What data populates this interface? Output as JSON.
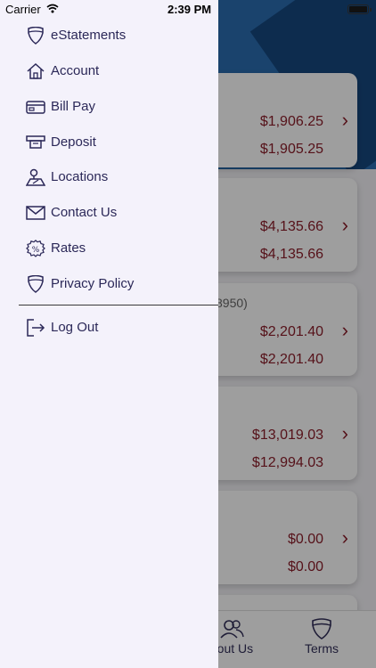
{
  "status_bar": {
    "carrier": "Carrier",
    "time": "2:39 PM"
  },
  "drawer": {
    "items": [
      {
        "label": "eStatements",
        "icon": "shield-icon"
      },
      {
        "label": "Account",
        "icon": "home-icon"
      },
      {
        "label": "Bill Pay",
        "icon": "card-icon"
      },
      {
        "label": "Deposit",
        "icon": "deposit-icon"
      },
      {
        "label": "Locations",
        "icon": "map-pin-icon"
      },
      {
        "label": "Contact Us",
        "icon": "envelope-icon"
      },
      {
        "label": "Rates",
        "icon": "percent-icon"
      },
      {
        "label": "Privacy Policy",
        "icon": "shield-icon"
      }
    ],
    "logout_label": "Log Out"
  },
  "background": {
    "cards": [
      {
        "amount1": "$1,906.25",
        "amount2": "$1,905.25"
      },
      {
        "amount1": "$4,135.66",
        "amount2": "$4,135.66"
      },
      {
        "account_fragment": "8950)",
        "amount1": "$2,201.40",
        "amount2": "$2,201.40"
      },
      {
        "amount1": "$13,019.03",
        "amount2": "$12,994.03"
      },
      {
        "amount1": "$0.00",
        "amount2": "$0.00"
      }
    ],
    "tabs": {
      "about_label": "bout Us",
      "terms_label": "Terms"
    }
  },
  "colors": {
    "amount_red": "#8b1e2a",
    "menu_text": "#2b2858",
    "drawer_bg": "#f4f2fb",
    "header_blue": "#0f3a6b"
  }
}
